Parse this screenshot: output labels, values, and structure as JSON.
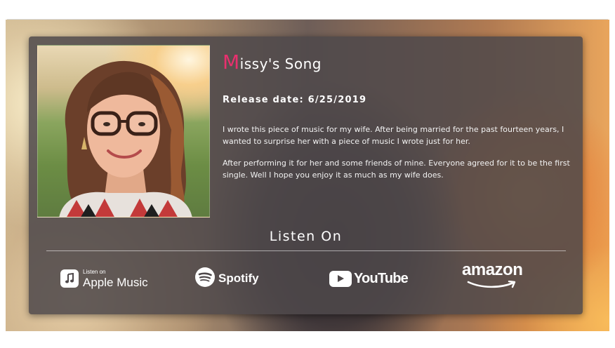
{
  "song": {
    "title_initial": "M",
    "title_rest": "issy's Song",
    "release_date": "Release date: 6/25/2019",
    "paragraphs": [
      "I wrote this piece of music for my wife. After being married for the past fourteen years, I wanted to surprise her with a piece of music I wrote just for her.",
      "After performing it for her and some friends of mine. Everyone agreed for it to be the first single. Well I hope you enjoy it as much as my wife does."
    ]
  },
  "listen": {
    "heading": "Listen On",
    "services": [
      {
        "name": "apple-music",
        "small_label": "Listen on",
        "label": "Apple Music",
        "icon": "apple-music-icon"
      },
      {
        "name": "spotify",
        "label": "Spotify",
        "icon": "spotify-icon"
      },
      {
        "name": "youtube",
        "label": "YouTube",
        "icon": "youtube-play-icon"
      },
      {
        "name": "amazon",
        "label": "amazon",
        "icon": "amazon-smile-icon"
      }
    ]
  },
  "colors": {
    "accent": "#e8306e",
    "card_background": "#4e484a",
    "text": "#ffffff"
  }
}
